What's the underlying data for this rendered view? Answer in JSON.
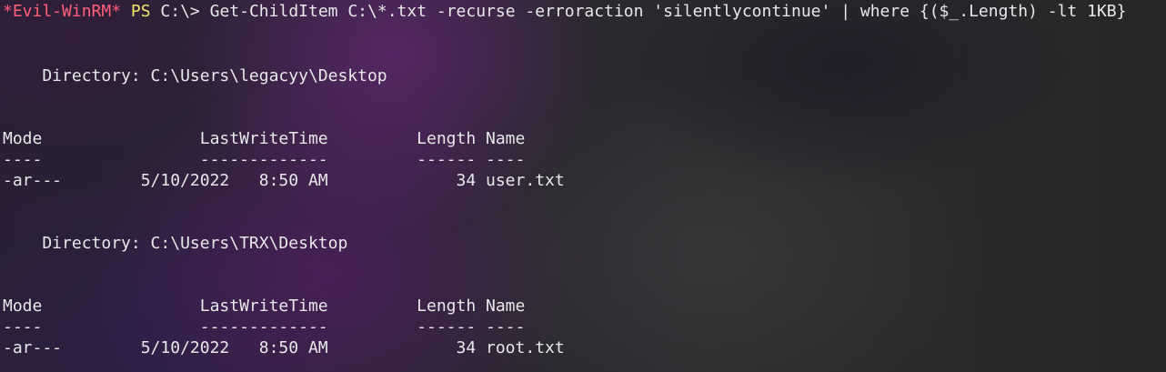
{
  "colors": {
    "prompt_tag": "#ff5f7a",
    "prompt_ps": "#f0e56d",
    "text": "#e8e8ea"
  },
  "prompt": {
    "tag": "*Evil-WinRM*",
    "ps": "PS",
    "path": "C:\\>",
    "command": "Get-ChildItem C:\\*.txt -recurse -erroraction 'silentlycontinue' | where {($_.Length) -lt 1KB}"
  },
  "results": [
    {
      "directory": "    Directory: C:\\Users\\legacyy\\Desktop",
      "header": "Mode                LastWriteTime         Length Name",
      "underline": "----                -------------         ------ ----",
      "rows": [
        "-ar---        5/10/2022   8:50 AM             34 user.txt"
      ]
    },
    {
      "directory": "    Directory: C:\\Users\\TRX\\Desktop",
      "header": "Mode                LastWriteTime         Length Name",
      "underline": "----                -------------         ------ ----",
      "rows": [
        "-ar---        5/10/2022   8:50 AM             34 root.txt"
      ]
    }
  ]
}
